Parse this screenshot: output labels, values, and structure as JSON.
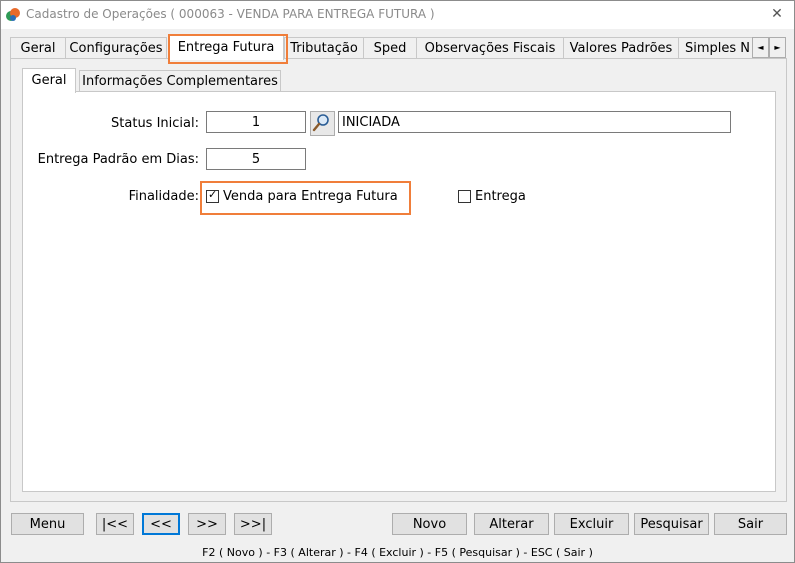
{
  "window": {
    "title": "Cadastro de Operações ( 000063 - VENDA PARA ENTREGA FUTURA )",
    "close_icon": "close-icon"
  },
  "tabs": [
    {
      "label": "Geral"
    },
    {
      "label": "Configurações"
    },
    {
      "label": "Entrega Futura"
    },
    {
      "label": "Tributação"
    },
    {
      "label": "Sped"
    },
    {
      "label": "Observações Fiscais"
    },
    {
      "label": "Valores Padrões"
    },
    {
      "label": "Simples N"
    }
  ],
  "tab_scroll": {
    "left": "◄",
    "right": "►"
  },
  "subtabs": [
    {
      "label": "Geral"
    },
    {
      "label": "Informações Complementares"
    }
  ],
  "form": {
    "status_label": "Status Inicial:",
    "status_value": "1",
    "status_desc": "INICIADA",
    "dias_label": "Entrega Padrão em Dias:",
    "dias_value": "5",
    "finalidade_label": "Finalidade:",
    "opt_venda": "Venda para Entrega Futura",
    "opt_venda_checked": true,
    "opt_entrega": "Entrega",
    "opt_entrega_checked": false
  },
  "buttons": {
    "menu": "Menu",
    "first": "|<<",
    "prev": "<<",
    "next": ">>",
    "last": ">>|",
    "novo": "Novo",
    "alterar": "Alterar",
    "excluir": "Excluir",
    "pesquisar": "Pesquisar",
    "sair": "Sair"
  },
  "statusbar": "F2 ( Novo )  -  F3 ( Alterar )  -  F4 ( Excluir )  -  F5 ( Pesquisar )  -  ESC ( Sair )",
  "colors": {
    "highlight": "#f07e3a",
    "focus": "#0078d7"
  }
}
